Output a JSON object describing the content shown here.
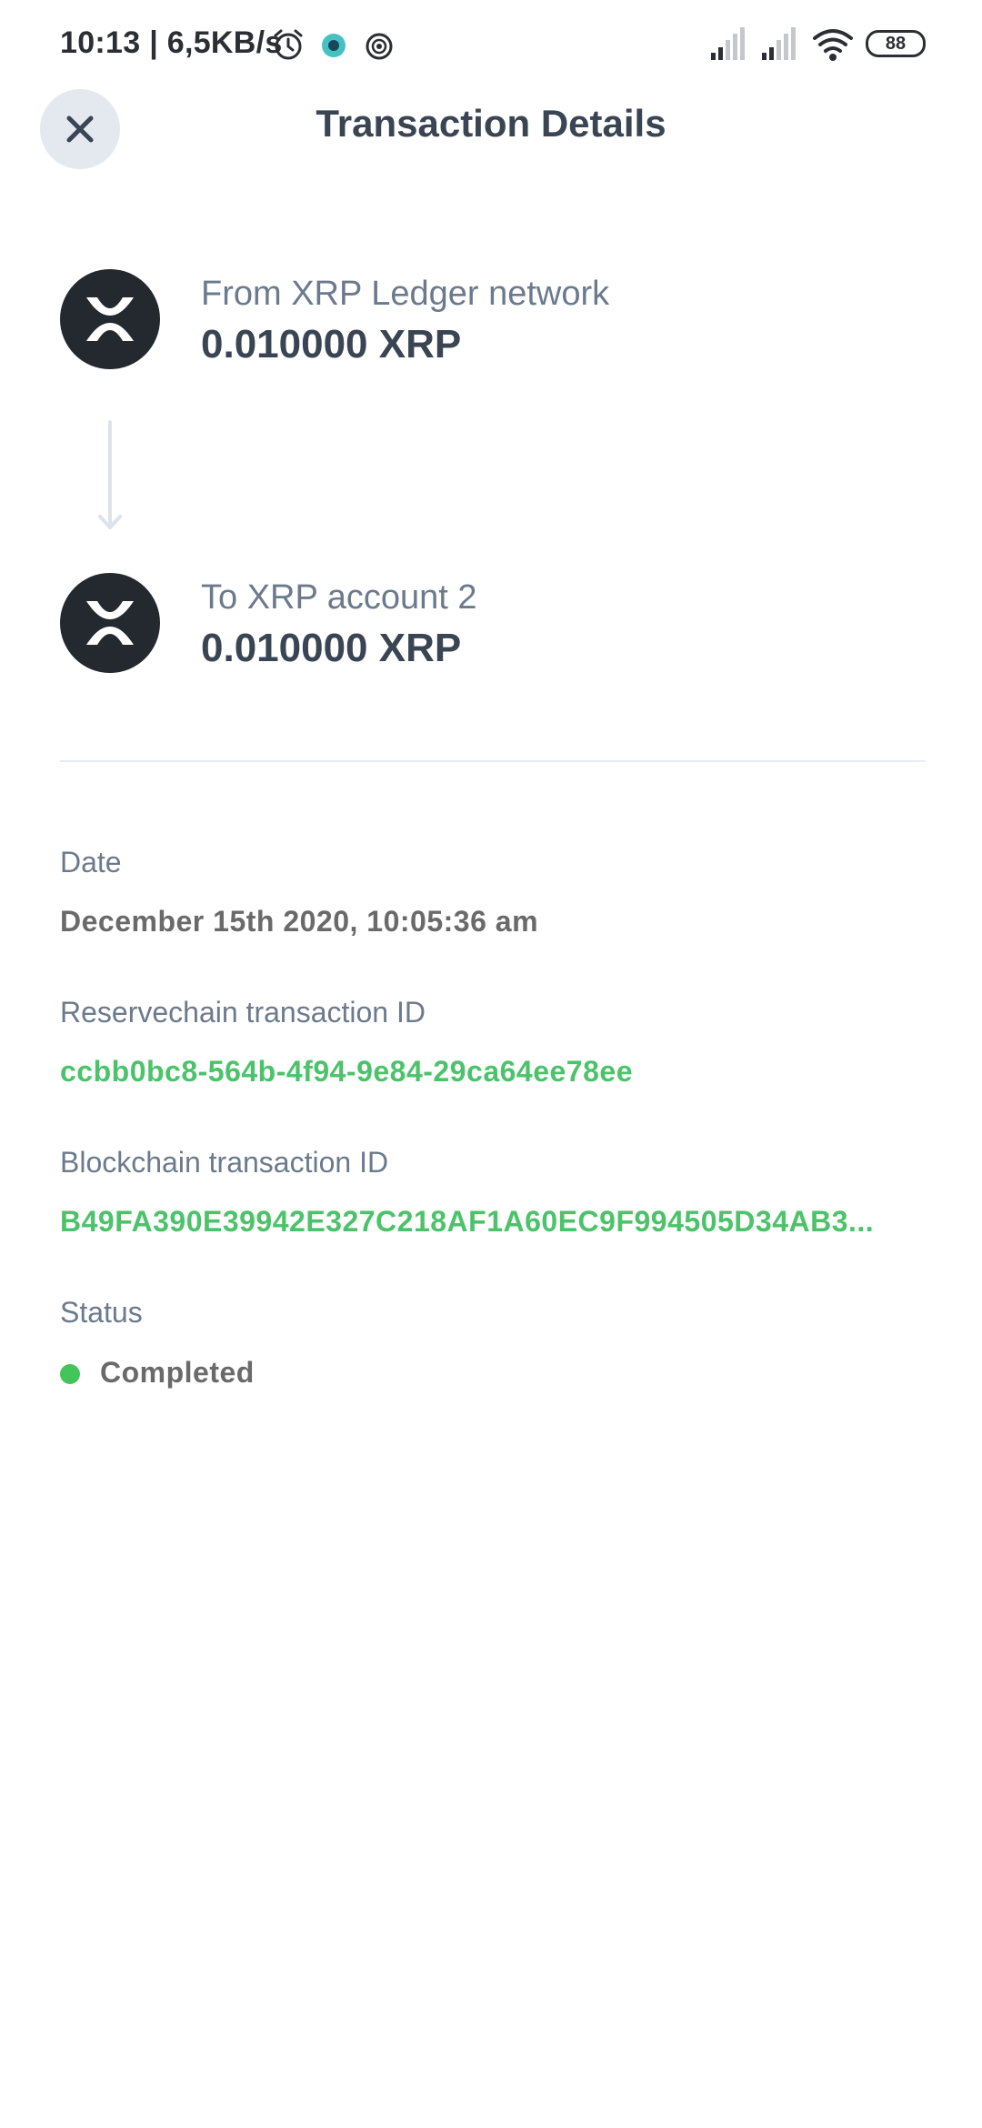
{
  "status_bar": {
    "time": "10:13 | 6,5KB/s",
    "battery": "88"
  },
  "header": {
    "title": "Transaction Details"
  },
  "transfer": {
    "from": {
      "label": "From XRP Ledger network",
      "amount": "0.010000 XRP"
    },
    "to": {
      "label": "To XRP account 2",
      "amount": "0.010000 XRP"
    }
  },
  "details": {
    "date_label": "Date",
    "date_value": "December 15th 2020, 10:05:36 am",
    "reservechain_label": "Reservechain transaction ID",
    "reservechain_value": "ccbb0bc8-564b-4f94-9e84-29ca64ee78ee",
    "blockchain_label": "Blockchain transaction ID",
    "blockchain_value": "B49FA390E39942E327C218AF1A60EC9F994505D34AB3...",
    "status_label": "Status",
    "status_value": "Completed"
  },
  "colors": {
    "link": "#4cc36a",
    "status_completed": "#43c55a",
    "coin_bg": "#23292f"
  },
  "icons": [
    "close-icon",
    "xrp-logo-icon",
    "arrow-down-icon",
    "alarm-icon",
    "signal-icon",
    "wifi-icon"
  ]
}
